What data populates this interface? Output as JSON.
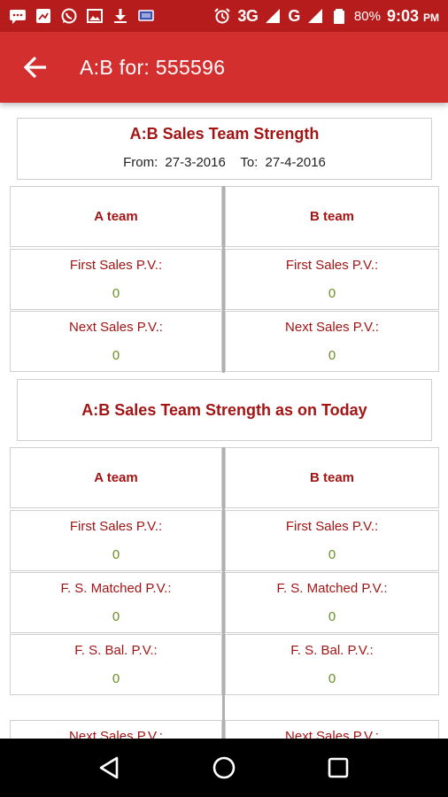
{
  "status_bar": {
    "network_3g": "3G",
    "network_g": "G",
    "battery": "80%",
    "time": "9:03",
    "ampm": "PM"
  },
  "app_bar": {
    "title": "A:B  for: 555596"
  },
  "section1": {
    "title": "A:B Sales Team Strength",
    "from_label": "From:",
    "from_value": "27-3-2016",
    "to_label": "To:",
    "to_value": "27-4-2016",
    "a_team": "A team",
    "b_team": "B team",
    "rows": [
      {
        "label": "First Sales P.V.:",
        "a_value": "0",
        "b_value": "0"
      },
      {
        "label": "Next Sales P.V.:",
        "a_value": "0",
        "b_value": "0"
      }
    ]
  },
  "section2": {
    "title": "A:B Sales Team Strength as on Today",
    "a_team": "A team",
    "b_team": "B team",
    "rows": [
      {
        "label": "First Sales P.V.:",
        "a_value": "0",
        "b_value": "0"
      },
      {
        "label": "F. S. Matched P.V.:",
        "a_value": "0",
        "b_value": "0"
      },
      {
        "label": "F. S. Bal. P.V.:",
        "a_value": "0",
        "b_value": "0"
      },
      {
        "label": "Next Sales P.V.:",
        "a_value": "",
        "b_value": ""
      }
    ]
  },
  "colors": {
    "status_bar": "#b71c1c",
    "app_bar": "#d32f2f",
    "heading_red": "#a31515",
    "value_green": "#6b8e23"
  },
  "icons": [
    "message-icon",
    "image-icon",
    "whatsapp-icon",
    "gallery-icon",
    "download-icon",
    "cast-icon",
    "alarm-icon",
    "signal-icon",
    "battery-icon",
    "back-arrow-icon",
    "nav-back-icon",
    "nav-home-icon",
    "nav-recents-icon"
  ]
}
